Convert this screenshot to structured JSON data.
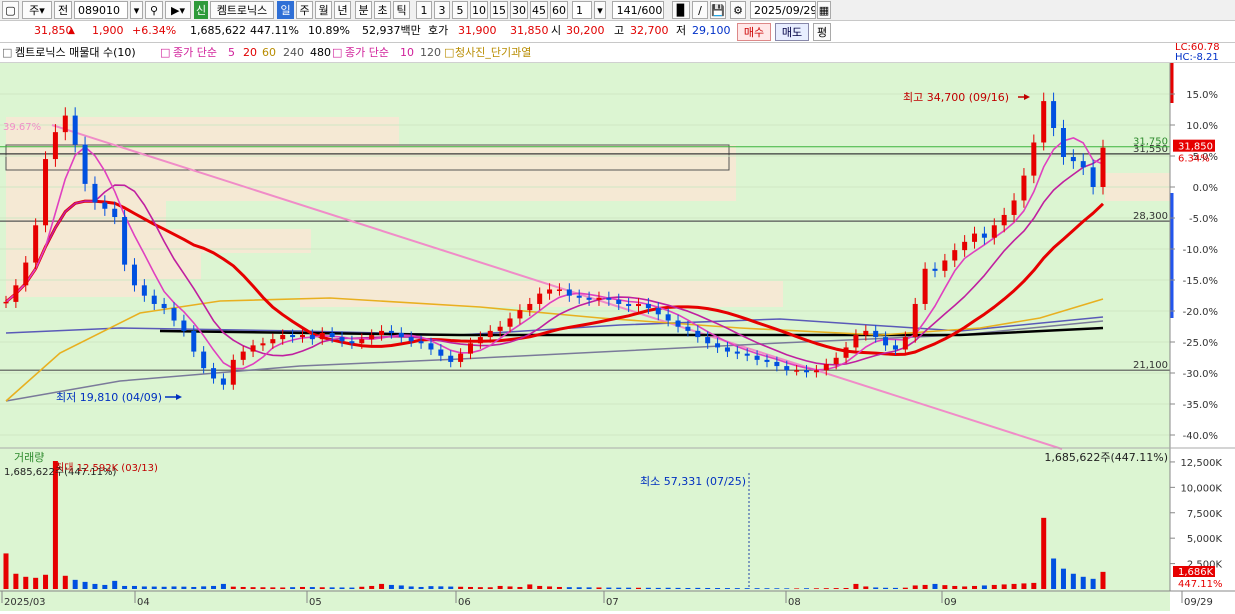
{
  "toolbar": {
    "menu_icon": "window-icon",
    "period_select": "주",
    "prev_label": "전",
    "code": "089010",
    "new_badge": "신",
    "stock_name": "켐트로닉스",
    "tabs": [
      "일",
      "주",
      "월",
      "년",
      "분",
      "초",
      "틱"
    ],
    "active_tab": "일",
    "intervals": [
      "1",
      "3",
      "5",
      "10",
      "15",
      "30",
      "45",
      "60"
    ],
    "interval_value": "1",
    "count": "141/600",
    "date": "2025/09/29"
  },
  "quote": {
    "price": "31,850",
    "change": "1,900",
    "change_rate": "+6.34%",
    "volume": "1,685,622",
    "volume_rate": "447.11%",
    "turnover": "10.89%",
    "amount": "52,937백만",
    "ask_label": "호가",
    "ask": "31,900",
    "bid": "31,850",
    "open_label": "시",
    "open": "30,200",
    "high_label": "고",
    "high": "32,700",
    "low_label": "저",
    "low": "29,100",
    "buy_label": "매수",
    "sell_label": "매도",
    "avg_label": "평"
  },
  "legend": {
    "title": "켐트로닉스 매물대 수(10)",
    "ma_label": "종가 단순",
    "ma_periods": [
      "5",
      "20",
      "60",
      "240",
      "480"
    ],
    "ma2_label": "종가 단순",
    "ma2_periods": [
      "10",
      "120"
    ],
    "signal": "청사진_단기과열",
    "lc": "LC:60.78",
    "hc": "HC:-8.21"
  },
  "chart_data": {
    "type": "candlestick",
    "x_ticks": [
      "2025/03",
      "04",
      "05",
      "06",
      "07",
      "08",
      "09",
      "09/29"
    ],
    "y_ticks": [
      "15.0%",
      "10.0%",
      "5.0%",
      "0.0%",
      "-5.0%",
      "-10.0%",
      "-15.0%",
      "-20.0%",
      "-25.0%",
      "-30.0%",
      "-35.0%",
      "-40.0%"
    ],
    "volume_ticks": [
      "12,500K",
      "10,000K",
      "7,500K",
      "5,000K",
      "2,500K"
    ],
    "reference_close": 29950,
    "current_price_label": "31,850",
    "current_rate_label": "6.34%",
    "current_volume_label": "1,686K",
    "current_volume_rate_label": "447.11%",
    "level_labels": [
      "31,550",
      "28,300",
      "21,100",
      "31,750"
    ],
    "annotations": {
      "high": "최고 34,700 (09/16)",
      "low": "최저 19,810 (04/09)",
      "start_rate": "39.67%",
      "volume_title": "거래량",
      "volume_current": "1,685,622주(447.11%)",
      "volume_max": "최대 12,592K (03/13)",
      "volume_min": "최소 57,331 (07/25)",
      "volume_left": "1,685,622주(447.11%)"
    },
    "closes": [
      24400,
      25200,
      26300,
      28100,
      31300,
      32600,
      33400,
      32000,
      30100,
      29200,
      28900,
      28500,
      26200,
      25200,
      24700,
      24300,
      24100,
      23500,
      23000,
      22000,
      21200,
      20700,
      20400,
      21600,
      22000,
      22300,
      22400,
      22600,
      22800,
      22700,
      22800,
      22600,
      22900,
      22700,
      22500,
      22400,
      22600,
      22800,
      23000,
      22900,
      22700,
      22500,
      22400,
      22100,
      21800,
      21500,
      21900,
      22400,
      22700,
      23000,
      23200,
      23600,
      24000,
      24300,
      24800,
      25000,
      25000,
      24700,
      24600,
      24500,
      24600,
      24500,
      24300,
      24200,
      24300,
      24100,
      23800,
      23500,
      23200,
      23000,
      22700,
      22400,
      22200,
      22000,
      21900,
      21800,
      21600,
      21500,
      21300,
      21100,
      21100,
      21000,
      21100,
      21400,
      21700,
      22200,
      22800,
      23000,
      22700,
      22300,
      22100,
      22700,
      24300,
      26000,
      25900,
      26400,
      26900,
      27300,
      27700,
      27500,
      28100,
      28600,
      29300,
      30500,
      32100,
      34100,
      32800,
      31400,
      31200,
      30900,
      29950,
      31850
    ],
    "volumes_k": [
      3500,
      1500,
      1200,
      1100,
      1400,
      12592,
      1300,
      900,
      700,
      500,
      400,
      800,
      300,
      300,
      250,
      240,
      220,
      250,
      230,
      200,
      260,
      300,
      500,
      230,
      200,
      180,
      170,
      160,
      150,
      180,
      200,
      190,
      170,
      160,
      150,
      140,
      220,
      300,
      500,
      400,
      350,
      250,
      200,
      280,
      260,
      240,
      220,
      200,
      180,
      170,
      300,
      250,
      200,
      450,
      300,
      250,
      200,
      180,
      170,
      160,
      150,
      140,
      130,
      130,
      120,
      120,
      110,
      120,
      110,
      100,
      110,
      100,
      95,
      90,
      85,
      80,
      80,
      75,
      70,
      65,
      57,
      75,
      70,
      80,
      90,
      100,
      500,
      250,
      150,
      120,
      110,
      130,
      350,
      400,
      500,
      380,
      300,
      250,
      300,
      350,
      400,
      450,
      500,
      550,
      600,
      7000,
      3000,
      2000,
      1500,
      1200,
      1000,
      1686
    ]
  }
}
